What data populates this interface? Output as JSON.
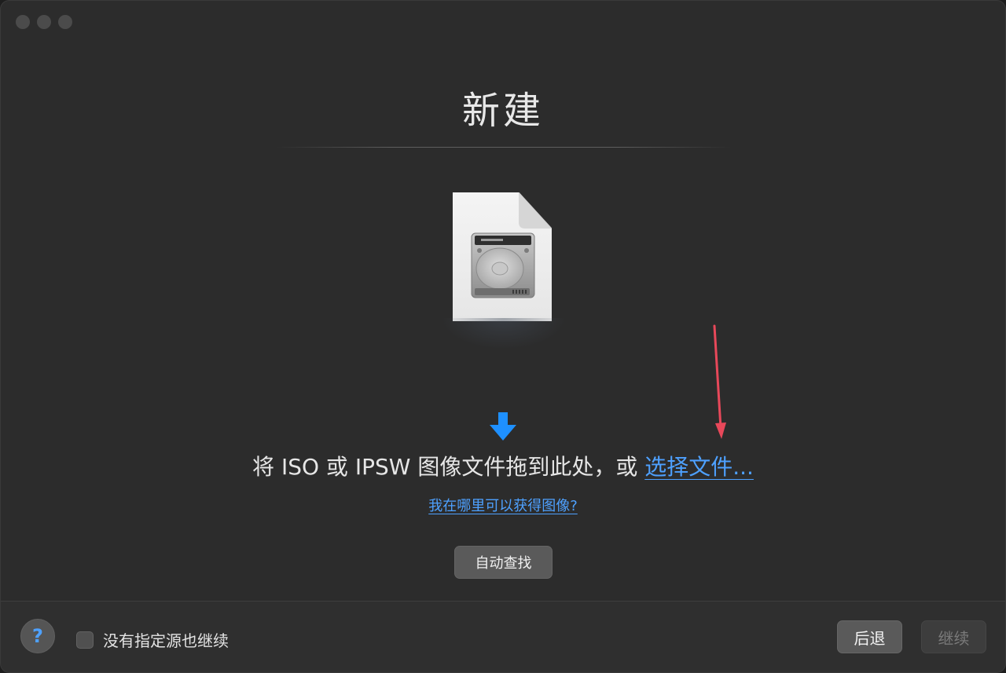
{
  "window": {
    "title": "新建",
    "traffic_lights": [
      "close-button",
      "minimize-button",
      "zoom-button"
    ]
  },
  "main": {
    "document_icon": "hard-disk-document-icon",
    "drop_arrow_icon": "arrow-down-icon",
    "drop_text": "将 ISO 或 IPSW 图像文件拖到此处，或",
    "choose_file_link": "选择文件...",
    "help_link": "我在哪里可以获得图像?",
    "auto_find_button": "自动查找"
  },
  "annotation": {
    "arrow_color": "#e8485a"
  },
  "footer": {
    "help_button": "?",
    "continue_without_source_label": "没有指定源也继续",
    "continue_without_source_checked": false,
    "back_button": "后退",
    "continue_button": "继续",
    "continue_enabled": false
  },
  "colors": {
    "accent": "#4ea1ff",
    "window_bg": "#2c2c2c"
  }
}
